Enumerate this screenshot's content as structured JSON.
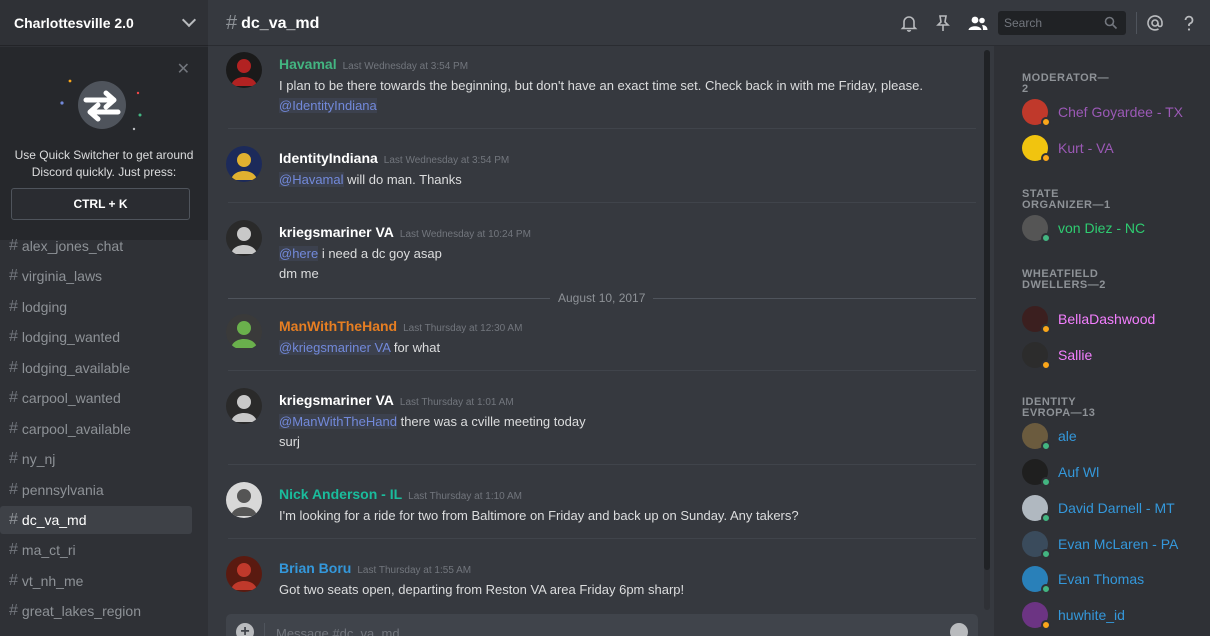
{
  "guild": {
    "name": "Charlottesville 2.0"
  },
  "quick_switcher": {
    "text": "Use Quick Switcher to get around Discord quickly. Just press:",
    "shortcut": "CTRL + K"
  },
  "channels": [
    {
      "name": "alex_jones_chat",
      "active": false
    },
    {
      "name": "virginia_laws",
      "active": false
    },
    {
      "name": "lodging",
      "active": false
    },
    {
      "name": "lodging_wanted",
      "active": false
    },
    {
      "name": "lodging_available",
      "active": false
    },
    {
      "name": "carpool_wanted",
      "active": false
    },
    {
      "name": "carpool_available",
      "active": false
    },
    {
      "name": "ny_nj",
      "active": false
    },
    {
      "name": "pennsylvania",
      "active": false
    },
    {
      "name": "dc_va_md",
      "active": true
    },
    {
      "name": "ma_ct_ri",
      "active": false
    },
    {
      "name": "vt_nh_me",
      "active": false
    },
    {
      "name": "great_lakes_region",
      "active": false
    }
  ],
  "header": {
    "channel": "dc_va_md",
    "search_placeholder": "Search",
    "icons": [
      "bell-icon",
      "pin-icon",
      "members-icon",
      "search-icon",
      "mention-icon",
      "help-icon"
    ]
  },
  "messages": [
    {
      "author": "Havamal",
      "author_color": "#43b581",
      "timestamp": "Last Wednesday at 3:54 PM",
      "avatar": {
        "bg": "#1a1a1a",
        "fg": "#b22222"
      },
      "lines": [
        {
          "text": "I plan to be there towards the beginning, but don't have an exact time set. Check back in with me Friday, please."
        },
        {
          "mention": "@IdentityIndiana",
          "text": ""
        }
      ]
    },
    {
      "author": "IdentityIndiana",
      "author_color": "#ffffff",
      "timestamp": "Last Wednesday at 3:54 PM",
      "avatar": {
        "bg": "#1c2a5a",
        "fg": "#e0b030"
      },
      "lines": [
        {
          "mention": "@Havamal",
          "text": " will do man. Thanks"
        }
      ]
    },
    {
      "author": "kriegsmariner VA",
      "author_color": "#ffffff",
      "timestamp": "Last Wednesday at 10:24 PM",
      "avatar": {
        "bg": "#2a2a2a",
        "fg": "#c8c8c8"
      },
      "lines": [
        {
          "mention": "@here",
          "text": " i need a dc goy asap"
        },
        {
          "text": "dm me"
        }
      ]
    },
    {
      "author": "ManWithTheHand",
      "author_color": "#e67e22",
      "timestamp": "Last Thursday at 12:30 AM",
      "avatar": {
        "bg": "#3a3a3a",
        "fg": "#6ab04c"
      },
      "lines": [
        {
          "mention": "@kriegsmariner VA",
          "text": " for what"
        }
      ]
    },
    {
      "author": "kriegsmariner VA",
      "author_color": "#ffffff",
      "timestamp": "Last Thursday at 1:01 AM",
      "avatar": {
        "bg": "#2a2a2a",
        "fg": "#c8c8c8"
      },
      "lines": [
        {
          "mention": "@ManWithTheHand",
          "text": " there was a cville meeting today"
        },
        {
          "text": "surj"
        }
      ]
    },
    {
      "author": "Nick Anderson - IL",
      "author_color": "#1abc9c",
      "timestamp": "Last Thursday at 1:10 AM",
      "avatar": {
        "bg": "#d8d8d8",
        "fg": "#555555"
      },
      "lines": [
        {
          "text": "I'm looking for a ride for two from Baltimore on Friday and back up on Sunday. Any takers?"
        }
      ]
    },
    {
      "author": "Brian Boru",
      "author_color": "#3498db",
      "timestamp": "Last Thursday at 1:55 AM",
      "avatar": {
        "bg": "#5a1a10",
        "fg": "#c0392b"
      },
      "lines": [
        {
          "text": "Got two seats open, departing from Reston VA area Friday 6pm sharp!"
        }
      ]
    }
  ],
  "date_divider": "August 10, 2017",
  "composer": {
    "placeholder": "Message #dc_va_md"
  },
  "member_groups": [
    {
      "title": "MODERATOR—2",
      "members": [
        {
          "name": "Chef Goyardee - TX",
          "color": "#9b59b6",
          "status": "#faa61a",
          "avatar": "#c0392b"
        },
        {
          "name": "Kurt - VA",
          "color": "#9b59b6",
          "status": "#faa61a",
          "avatar": "#f1c40f"
        }
      ]
    },
    {
      "title": "STATE ORGANIZER—1",
      "members": [
        {
          "name": "von Diez - NC",
          "color": "#2ecc71",
          "status": "#43b581",
          "avatar": "#555555"
        }
      ]
    },
    {
      "title": "WHEATFIELD DWELLERS—2",
      "members": [
        {
          "name": "BellaDashwood",
          "color": "#f47fff",
          "status": "#faa61a",
          "avatar": "#3b1f1f"
        },
        {
          "name": "Sallie",
          "color": "#f47fff",
          "status": "#faa61a",
          "avatar": "#2c2c2c"
        }
      ]
    },
    {
      "title": "IDENTITY EVROPA—13",
      "members": [
        {
          "name": "ale",
          "color": "#3498db",
          "status": "#43b581",
          "avatar": "#6b5b3e"
        },
        {
          "name": "Auf Wl",
          "color": "#3498db",
          "status": "#43b581",
          "avatar": "#1f1f1f"
        },
        {
          "name": "David Darnell - MT",
          "color": "#3498db",
          "status": "#43b581",
          "avatar": "#b0b8c0"
        },
        {
          "name": "Evan McLaren - PA",
          "color": "#3498db",
          "status": "#43b581",
          "avatar": "#3a4b5c"
        },
        {
          "name": "Evan Thomas",
          "color": "#3498db",
          "status": "#43b581",
          "avatar": "#2980b9"
        },
        {
          "name": "huwhite_id",
          "color": "#3498db",
          "status": "#faa61a",
          "avatar": "#6c3483"
        }
      ]
    }
  ]
}
